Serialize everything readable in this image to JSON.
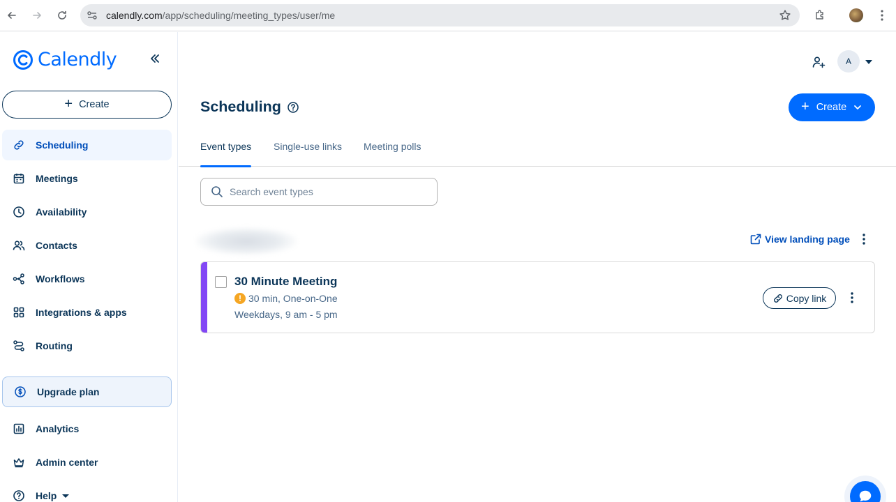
{
  "browser": {
    "url_host": "calendly.com",
    "url_path": "/app/scheduling/meeting_types/user/me"
  },
  "sidebar": {
    "logo_text": "Calendly",
    "create_label": "Create",
    "items": [
      {
        "label": "Scheduling",
        "icon": "link-icon",
        "active": true
      },
      {
        "label": "Meetings",
        "icon": "calendar-icon"
      },
      {
        "label": "Availability",
        "icon": "clock-icon"
      },
      {
        "label": "Contacts",
        "icon": "contacts-icon"
      },
      {
        "label": "Workflows",
        "icon": "workflows-icon"
      },
      {
        "label": "Integrations & apps",
        "icon": "grid-icon"
      },
      {
        "label": "Routing",
        "icon": "routing-icon"
      }
    ],
    "upgrade_label": "Upgrade plan",
    "bottom_items": [
      {
        "label": "Analytics",
        "icon": "bar-chart-icon"
      },
      {
        "label": "Admin center",
        "icon": "crown-icon"
      },
      {
        "label": "Help",
        "icon": "help-icon"
      }
    ]
  },
  "header": {
    "avatar_initial": "A",
    "title": "Scheduling",
    "create_label": "Create"
  },
  "tabs": [
    {
      "label": "Event types",
      "active": true
    },
    {
      "label": "Single-use links"
    },
    {
      "label": "Meeting polls"
    }
  ],
  "search": {
    "placeholder": "Search event types",
    "value": ""
  },
  "landing": {
    "label": "View landing page"
  },
  "event": {
    "title": "30 Minute Meeting",
    "details": "30 min, One-on-One",
    "hours": "Weekdays, 9 am - 5 pm",
    "copy_label": "Copy link",
    "color": "#8247f5"
  },
  "colors": {
    "accent": "#006bff",
    "text": "#0b3558"
  }
}
